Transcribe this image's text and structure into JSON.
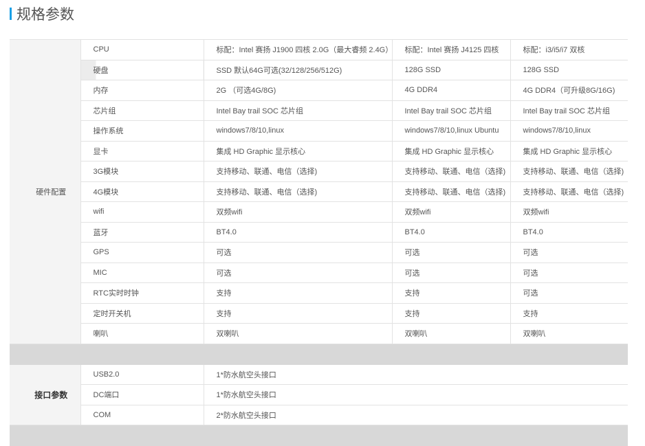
{
  "page": {
    "title": "规格参数"
  },
  "hardware": {
    "section_label": "硬件配置",
    "rows": [
      {
        "label": "CPU",
        "v1": "标配：Intel 赛扬 J1900 四核 2.0G（最大睿频 2.4G）",
        "v2": "标配：Intel 赛扬 J4125 四核",
        "v3": "标配：i3/i5/i7 双核"
      },
      {
        "label": "硬盘",
        "v1": "SSD 默认64G可选(32/128/256/512G)",
        "v2": "128G SSD",
        "v3": "128G SSD"
      },
      {
        "label": "内存",
        "v1": "2G （可选4G/8G)",
        "v2": "4G DDR4",
        "v3": "4G DDR4（可升级8G/16G)"
      },
      {
        "label": "芯片组",
        "v1": "Intel Bay trail SOC 芯片组",
        "v2": "Intel Bay trail SOC 芯片组",
        "v3": "Intel Bay trail SOC 芯片组"
      },
      {
        "label": "操作系统",
        "v1": "windows7/8/10,linux",
        "v2": "windows7/8/10,linux Ubuntu",
        "v3": "windows7/8/10,linux"
      },
      {
        "label": "显卡",
        "v1": "集成 HD Graphic 显示核心",
        "v2": "集成 HD Graphic 显示核心",
        "v3": "集成 HD Graphic 显示核心"
      },
      {
        "label": "3G模块",
        "v1": "支持移动、联通、电信（选择)",
        "v2": "支持移动、联通、电信（选择)",
        "v3": "支持移动、联通、电信（选择)"
      },
      {
        "label": "4G模块",
        "v1": "支持移动、联通、电信（选择)",
        "v2": "支持移动、联通、电信（选择)",
        "v3": "支持移动、联通、电信（选择)"
      },
      {
        "label": "wifi",
        "v1": "双频wifi",
        "v2": "双频wifi",
        "v3": "双频wifi"
      },
      {
        "label": "蓝牙",
        "v1": "BT4.0",
        "v2": "BT4.0",
        "v3": "BT4.0"
      },
      {
        "label": "GPS",
        "v1": "可选",
        "v2": "可选",
        "v3": "可选"
      },
      {
        "label": "MIC",
        "v1": "可选",
        "v2": "可选",
        "v3": "可选"
      },
      {
        "label": "RTC实时时钟",
        "v1": "支持",
        "v2": "支持",
        "v3": "可选"
      },
      {
        "label": "定时开关机",
        "v1": "支持",
        "v2": "支持",
        "v3": "支持"
      },
      {
        "label": "喇叭",
        "v1": "双喇叭",
        "v2": "双喇叭",
        "v3": "双喇叭"
      }
    ]
  },
  "ports": {
    "section_label": "接口参数",
    "rows": [
      {
        "label": "USB2.0",
        "value": "1*防水航空头接口"
      },
      {
        "label": "DC端口",
        "value": "1*防水航空头接口"
      },
      {
        "label": "COM",
        "value": "2*防水航空头接口"
      }
    ]
  }
}
